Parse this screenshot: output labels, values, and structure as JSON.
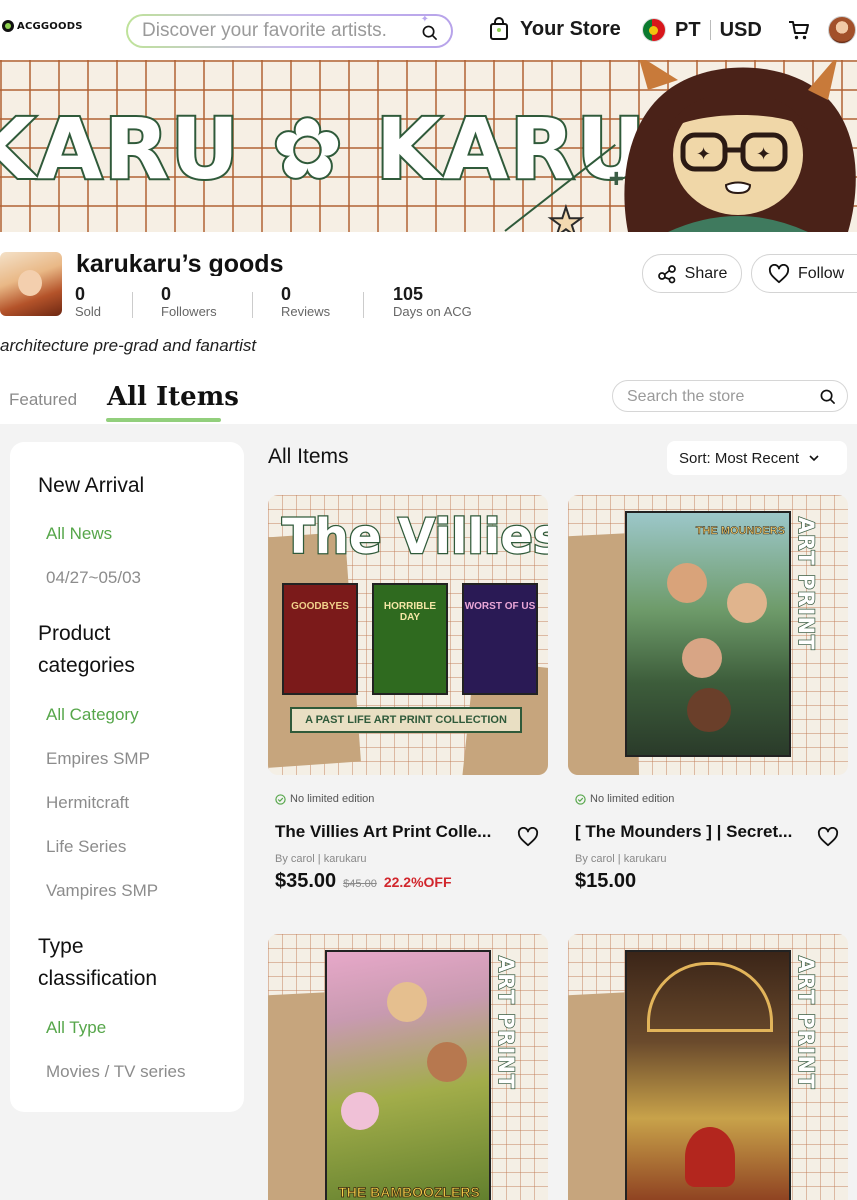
{
  "brand": {
    "logo_text": "ACGGOODS"
  },
  "header": {
    "search_placeholder": "Discover your favorite artists.",
    "your_store": "Your Store",
    "language": "PT",
    "currency": "USD"
  },
  "banner": {
    "title": "KARU ✿ KARU"
  },
  "store": {
    "name": "karukaru’s goods",
    "bio": "architecture pre-grad and fanartist",
    "stats": [
      {
        "value": "0",
        "label": "Sold"
      },
      {
        "value": "0",
        "label": "Followers"
      },
      {
        "value": "0",
        "label": "Reviews"
      },
      {
        "value": "105",
        "label": "Days on ACG"
      }
    ],
    "share_label": "Share",
    "follow_label": "Follow"
  },
  "tabs": {
    "featured": "Featured",
    "all_items": "All Items",
    "search_placeholder": "Search the store"
  },
  "sidebar": {
    "new_arrival": {
      "heading": "New Arrival",
      "items": [
        "All News",
        "04/27~05/03"
      ]
    },
    "product_categories": {
      "heading_line1": "Product",
      "heading_line2": "categories",
      "items": [
        "All Category",
        "Empires SMP",
        "Hermitcraft",
        "Life Series",
        "Vampires SMP"
      ]
    },
    "type_classification": {
      "heading_line1": "Type",
      "heading_line2": "classification",
      "items": [
        "All Type",
        "Movies / TV series"
      ]
    }
  },
  "main": {
    "title": "All Items",
    "sort_label": "Sort: Most Recent"
  },
  "products": [
    {
      "badge": "No limited edition",
      "title": "The Villies Art Print Colle...",
      "by": "By carol | karukaru",
      "price": "$35.00",
      "old_price": "$45.00",
      "discount": "22.2%OFF",
      "art": {
        "headline": "The Villies",
        "posters": [
          "GOODBYES",
          "HORRIBLE DAY",
          "WORST OF US"
        ],
        "banner": "A PAST LIFE ART PRINT COLLECTION"
      }
    },
    {
      "badge": "No limited edition",
      "title": "[ The Mounders ] | Secret...",
      "by": "By carol | karukaru",
      "price": "$15.00",
      "art": {
        "poster_title": "THE MOUNDERS",
        "side_text": "ART PRINT"
      }
    },
    {
      "art": {
        "poster_title": "THE BAMBOOZLERS",
        "side_text": "ART PRINT"
      }
    },
    {
      "art": {
        "side_text": "ART PRINT"
      }
    }
  ],
  "colors": {
    "accent_green": "#56a64a",
    "tab_underline": "#92cf7c",
    "discount_red": "#d1262c",
    "banner_outline": "#2f5a3a"
  }
}
